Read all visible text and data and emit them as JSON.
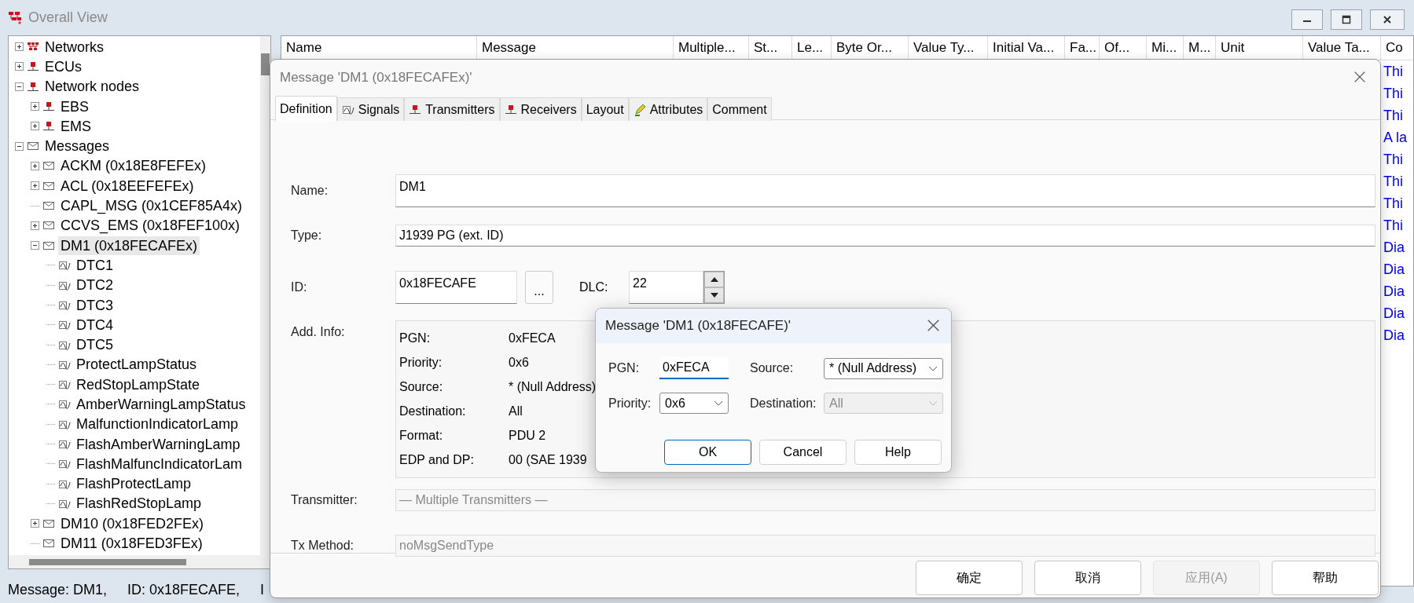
{
  "window": {
    "title": "Overall View"
  },
  "tree": {
    "items": [
      {
        "label": "Networks",
        "kind": "network",
        "expanded": false,
        "selected": false
      },
      {
        "label": "ECUs",
        "kind": "ecu",
        "expanded": false,
        "selected": false
      },
      {
        "label": "Network nodes",
        "kind": "node",
        "expanded": true,
        "selected": false,
        "children": [
          {
            "label": "EBS",
            "kind": "node",
            "expanded": false,
            "selected": false
          },
          {
            "label": "EMS",
            "kind": "node",
            "expanded": false,
            "selected": false
          }
        ]
      },
      {
        "label": "Messages",
        "kind": "message",
        "expanded": true,
        "selected": false,
        "children": [
          {
            "label": "ACKM (0x18E8FEFEx)",
            "kind": "message",
            "expanded": false,
            "selected": false
          },
          {
            "label": "ACL (0x18EEFEFEx)",
            "kind": "message",
            "expanded": false,
            "selected": false
          },
          {
            "label": "CAPL_MSG (0x1CEF85A4x)",
            "kind": "message",
            "selected": false
          },
          {
            "label": "CCVS_EMS (0x18FEF100x)",
            "kind": "message",
            "expanded": false,
            "selected": false
          },
          {
            "label": "DM1 (0x18FECAFEx)",
            "kind": "message",
            "expanded": true,
            "selected": true,
            "children": [
              {
                "label": "DTC1",
                "kind": "signal",
                "selected": false
              },
              {
                "label": "DTC2",
                "kind": "signal",
                "selected": false
              },
              {
                "label": "DTC3",
                "kind": "signal",
                "selected": false
              },
              {
                "label": "DTC4",
                "kind": "signal",
                "selected": false
              },
              {
                "label": "DTC5",
                "kind": "signal",
                "selected": false
              },
              {
                "label": "ProtectLampStatus",
                "kind": "signal",
                "selected": false
              },
              {
                "label": "RedStopLampState",
                "kind": "signal",
                "selected": false
              },
              {
                "label": "AmberWarningLampStatus",
                "kind": "signal",
                "selected": false
              },
              {
                "label": "MalfunctionIndicatorLamp",
                "kind": "signal",
                "selected": false
              },
              {
                "label": "FlashAmberWarningLamp",
                "kind": "signal",
                "selected": false
              },
              {
                "label": "FlashMalfuncIndicatorLam",
                "kind": "signal",
                "selected": false
              },
              {
                "label": "FlashProtectLamp",
                "kind": "signal",
                "selected": false
              },
              {
                "label": "FlashRedStopLamp",
                "kind": "signal",
                "selected": false
              }
            ]
          },
          {
            "label": "DM10 (0x18FED2FEx)",
            "kind": "message",
            "expanded": false,
            "selected": false
          },
          {
            "label": "DM11 (0x18FED3FEx)",
            "kind": "message",
            "selected": false
          }
        ]
      }
    ]
  },
  "table": {
    "columns": [
      "Name",
      "Message",
      "Multiple...",
      "St...",
      "Le...",
      "Byte Or...",
      "Value Ty...",
      "Initial Va...",
      "Fa...",
      "Of...",
      "Mi...",
      "M...",
      "Unit",
      "Value Ta...",
      "Co"
    ],
    "rows": [
      {
        "cells": [
          "Thi"
        ]
      },
      {
        "cells": [
          "Thi"
        ]
      },
      {
        "cells": [
          "Thi"
        ]
      },
      {
        "cells": [
          "A la"
        ]
      },
      {
        "cells": [
          "Thi"
        ]
      },
      {
        "cells": [
          "Thi"
        ]
      },
      {
        "cells": [
          "Thi"
        ]
      },
      {
        "cells": [
          "Thi"
        ]
      },
      {
        "cells": [
          "Dia"
        ]
      },
      {
        "cells": [
          "Dia"
        ]
      },
      {
        "cells": [
          "Dia"
        ]
      },
      {
        "cells": [
          "Dia"
        ]
      },
      {
        "cells": [
          "Dia"
        ]
      }
    ]
  },
  "status_bar": {
    "texts": [
      "Message: DM1,",
      "ID: 0x18FECAFE,",
      "I"
    ]
  },
  "message_dialog": {
    "title": "Message 'DM1 (0x18FECAFEx)'",
    "tabs": [
      {
        "label": "Definition",
        "selected": true
      },
      {
        "label": "Signals",
        "selected": false
      },
      {
        "label": "Transmitters",
        "selected": false
      },
      {
        "label": "Receivers",
        "selected": false
      },
      {
        "label": "Layout",
        "selected": false
      },
      {
        "label": "Attributes",
        "selected": false
      },
      {
        "label": "Comment",
        "selected": false
      }
    ],
    "form": {
      "name": {
        "label": "Name:",
        "value": "DM1",
        "disabled": false
      },
      "type": {
        "label": "Type:",
        "value": "J1939 PG (ext. ID)",
        "disabled": false
      },
      "id": {
        "label": "ID:",
        "value": "0x18FECAFE",
        "disabled": false,
        "browse_button": "..."
      },
      "dlc": {
        "label": "DLC:",
        "value": "22"
      },
      "add_info": {
        "label": "Add. Info:",
        "rows": [
          {
            "key": "PGN:",
            "value": "0xFECA"
          },
          {
            "key": "Priority:",
            "value": "0x6"
          },
          {
            "key": "Source:",
            "value": "* (Null Address)"
          },
          {
            "key": "Destination:",
            "value": "All"
          },
          {
            "key": "Format:",
            "value": "PDU 2"
          },
          {
            "key": "EDP and DP:",
            "value": "00 (SAE 1939"
          }
        ]
      },
      "transmitter": {
        "label": "Transmitter:",
        "value": "— Multiple Transmitters —",
        "disabled": true
      },
      "tx_method": {
        "label": "Tx Method:",
        "value": "noMsgSendType",
        "disabled": true
      }
    },
    "buttons": [
      {
        "label": "确定",
        "disabled": false
      },
      {
        "label": "取消",
        "disabled": false
      },
      {
        "label": "应用(A)",
        "disabled": true
      },
      {
        "label": "帮助",
        "disabled": false
      }
    ]
  },
  "pgn_dialog": {
    "title": "Message 'DM1 (0x18FECAFE)'",
    "fields": [
      {
        "label": "PGN:",
        "value": "0xFECA",
        "kind": "text"
      },
      {
        "label": "Source:",
        "value": "* (Null Address)",
        "kind": "combo",
        "disabled": false
      },
      {
        "label": "Priority:",
        "value": "0x6",
        "kind": "combo",
        "disabled": false
      },
      {
        "label": "Destination:",
        "value": "All",
        "kind": "combo",
        "disabled": true
      }
    ],
    "buttons": [
      {
        "label": "OK",
        "default": true
      },
      {
        "label": "Cancel",
        "default": false
      },
      {
        "label": "Help",
        "default": false
      }
    ]
  }
}
